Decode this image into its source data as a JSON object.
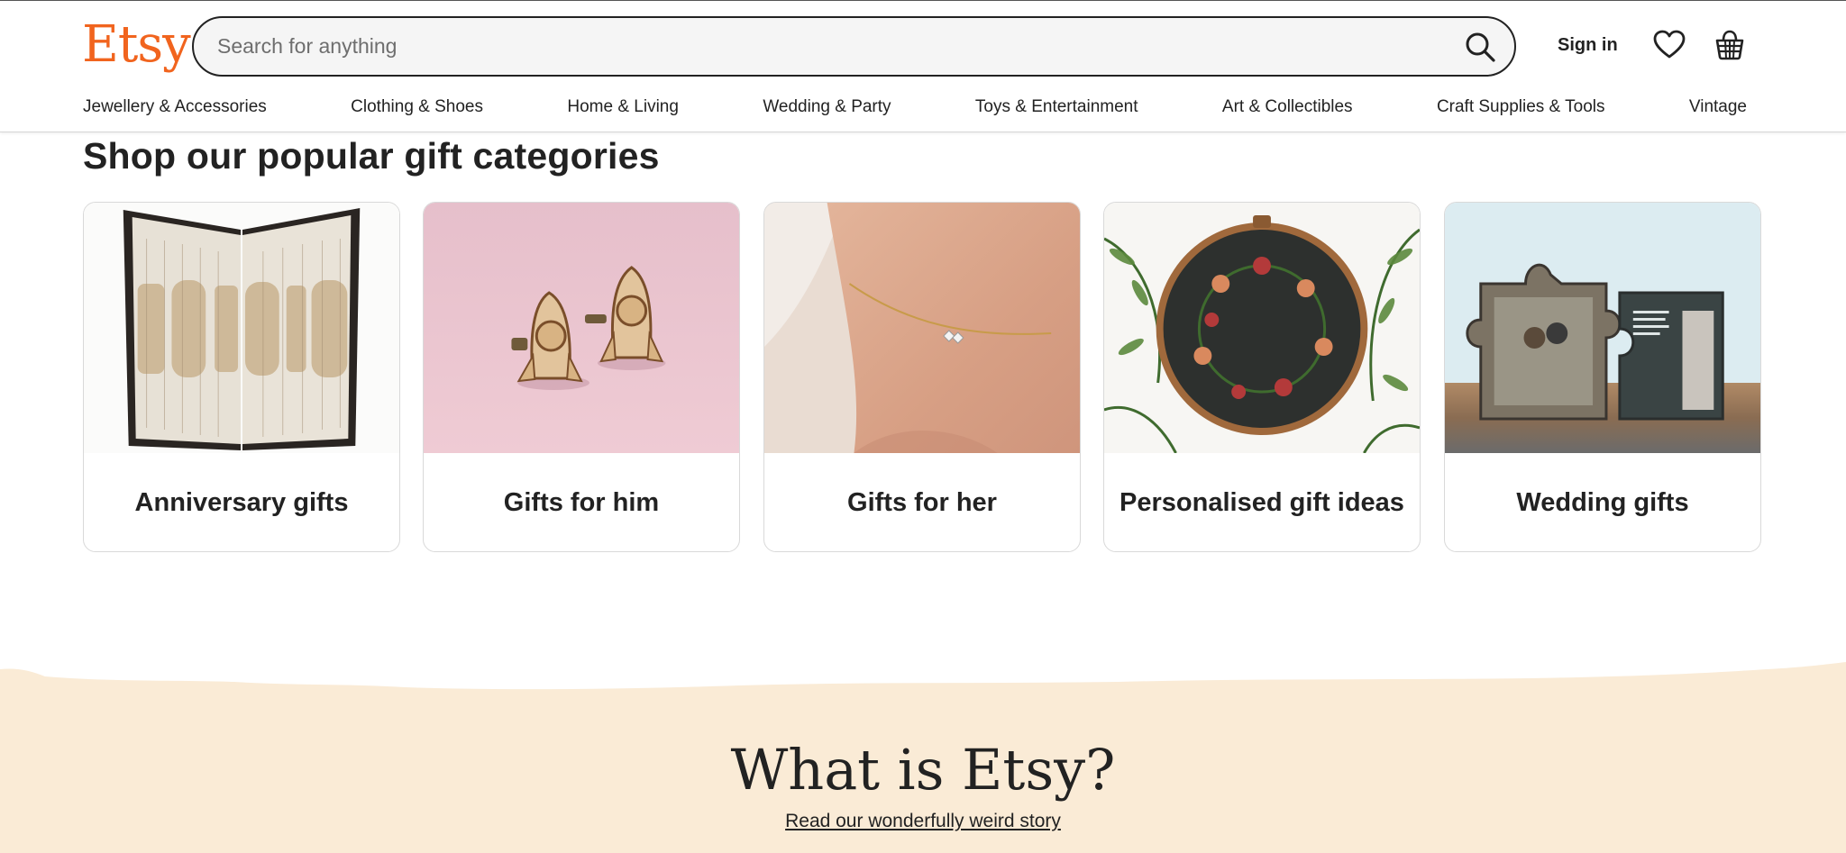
{
  "header": {
    "logo": "Etsy",
    "search": {
      "placeholder": "Search for anything",
      "value": ""
    },
    "sign_in": "Sign in",
    "icons": [
      "search-icon",
      "heart-icon",
      "basket-icon"
    ],
    "brand_color": "#F1641E"
  },
  "nav": {
    "items": [
      "Jewellery & Accessories",
      "Clothing & Shoes",
      "Home & Living",
      "Wedding & Party",
      "Toys & Entertainment",
      "Art & Collectibles",
      "Craft Supplies & Tools",
      "Vintage"
    ]
  },
  "gift_section": {
    "title": "Shop our popular gift categories",
    "cards": [
      {
        "label": "Anniversary gifts"
      },
      {
        "label": "Gifts for him"
      },
      {
        "label": "Gifts for her"
      },
      {
        "label": "Personalised gift ideas"
      },
      {
        "label": "Wedding gifts"
      }
    ]
  },
  "about": {
    "title": "What is Etsy?",
    "link": "Read our wonderfully weird story",
    "background_color": "#FAEBD6"
  }
}
